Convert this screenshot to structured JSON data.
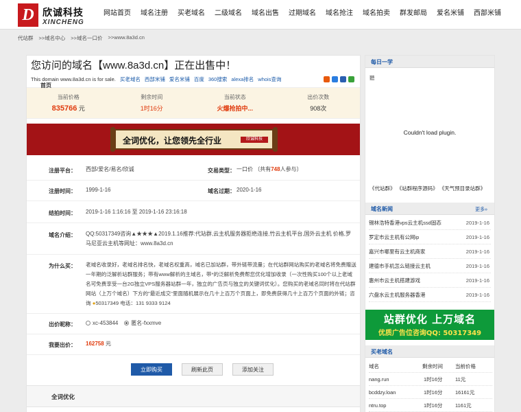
{
  "brand": {
    "name_cn": "欣诚科技",
    "name_en": "XINCHENG",
    "mark": "D"
  },
  "nav": [
    "网站首页",
    "域名注册",
    "买老域名",
    "二级域名",
    "域名出售",
    "过期域名",
    "域名抢注",
    "域名拍卖",
    "群发邮局",
    "爱名米铺",
    "西部米铺"
  ],
  "breadcrumb": [
    "代站群",
    ">>域名中心",
    ">>域名一口价",
    ">>www.8a3d.cn"
  ],
  "main": {
    "title": "您访问的域名【www.8a3d.cn】正在出售中！",
    "sale_prefix": "This domain",
    "sale_domain": "www.8a3d.cn",
    "sale_suffix": "is for sale.",
    "links": [
      "买老域名",
      "西部米铺",
      "爱名米铺",
      "百度",
      "360搜索",
      "alexa排名",
      "whois查询"
    ],
    "stats": [
      {
        "label": "当前价格",
        "value": "835766",
        "unit": "元"
      },
      {
        "label": "剩余时间",
        "value": "1时16分"
      },
      {
        "label": "当前状态",
        "value": "火爆抢拍中..."
      },
      {
        "label": "出价次数",
        "value": "908次"
      }
    ],
    "banner_text": "全词优化，让您领先全行业",
    "banner_seal": "欣诚科技",
    "rows": {
      "reg_platform_label": "注册平台：",
      "reg_platform": "西部/爱名/易名/欣诚",
      "trade_type_label": "交易类型：",
      "trade_type_pre": "一口价 （共有",
      "trade_count": "748",
      "trade_type_post": "人参与）",
      "reg_date_label": "注册时间：",
      "reg_date": "1999-1-16",
      "expire_label": "域名过期：",
      "expire": "2020-1-16",
      "end_label": "结拍时间：",
      "end_time": "2019-1-16 1:16:16 至 2019-1-16 23:16:18",
      "intro_label": "域名介绍：",
      "intro": "QQ:50317349咨询▲★★★▲2019.1.16推荐:代站群,云主机服务器拒绝连接,竹云主机平台,国外云主机 价格,罗马尼亚云主机等网址：www.8a3d.cn",
      "why_label": "为什么买：",
      "why": "老域名收录好，老域名排名快，老域名权重高，域名已加站群，带外链带流量；在代站群网站购买的老域名将免费赠送一年期的泛解析站群服务；带有www解析的主域名，带*的泛解析免费帮您优化增加收录（一次性购买100个以上老域名可免费享受一台2G独立VPS服务器站群一年，独立的广告页与独立的关键词优化）。您购买的老域名同时将在代站群网站（上万个域名）下方的\"最近成交\"里面随机展示在几十上百万个页面上，即免费获得几十上百万个页面的外链；咨询",
      "why_qq": "50317349 电话：131 9333 9124",
      "nick_label": "出价昵称：",
      "nick_opt1": "xc-453844",
      "nick_opt2": "匿名-fxxmve",
      "bid_label": "我要出价：",
      "bid_value": "162758",
      "bid_unit": "元"
    },
    "buttons": [
      "立即购买",
      "刷新此页",
      "添加关注"
    ],
    "seo_title": "全词优化",
    "seo_sub": "首页"
  },
  "side": {
    "daily_title": "每日一学",
    "daily_item": "聽",
    "plugin_msg": "Couldn't load plugin.",
    "blog_links": [
      "《代站群》",
      "《站群程序源码》",
      "《天气预目录站群》"
    ],
    "news_title": "域名新闻",
    "more": "更多»",
    "news": [
      {
        "title": "锡林浩特香港vps云主机ssd固态",
        "date": "2019-1-16"
      },
      {
        "title": "罗定市云主机有公网ip",
        "date": "2019-1-16"
      },
      {
        "title": "嘉兴市哪里有云主机商家",
        "date": "2019-1-16"
      },
      {
        "title": "建德市手机怎么链接云主机",
        "date": "2019-1-16"
      },
      {
        "title": "惠州市云主机搭建游戏",
        "date": "2019-1-16"
      },
      {
        "title": "六盘水云主机服务器香港",
        "date": "2019-1-16"
      }
    ],
    "ad_line1": "站群优化 上万域名",
    "ad_line2": "优质广告位咨询QQ: 50317349",
    "old_title": "买老域名",
    "old_headers": [
      "域名",
      "剩余时间",
      "当前价格"
    ],
    "old_rows": [
      {
        "domain": "nang.run",
        "time": "1时16分",
        "price": "11元"
      },
      {
        "domain": "bcddzy.loan",
        "time": "1时16分",
        "price": "16161元"
      },
      {
        "domain": "ntru.top",
        "time": "1时16分",
        "price": "1161元"
      }
    ]
  },
  "colors": {
    "accent": "#1f5aa8",
    "red": "#e03a0c",
    "banner": "#a31316",
    "ad": "#0e9a3a"
  }
}
